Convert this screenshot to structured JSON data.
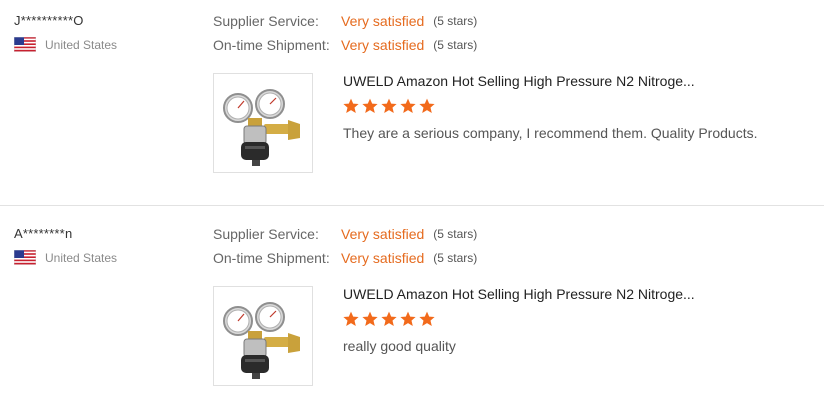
{
  "reviews": [
    {
      "buyer": "J**********O",
      "country": "United States",
      "supplier_service_label": "Supplier Service:",
      "supplier_service_value": "Very satisfied",
      "supplier_service_stars": "(5 stars)",
      "shipment_label": "On-time Shipment:",
      "shipment_value": "Very satisfied",
      "shipment_stars": "(5 stars)",
      "product_title": "UWELD Amazon Hot Selling High Pressure N2 Nitroge...",
      "rating": 5,
      "comment": "They are a serious company, I recommend them. Quality Products."
    },
    {
      "buyer": "A********n",
      "country": "United States",
      "supplier_service_label": "Supplier Service:",
      "supplier_service_value": "Very satisfied",
      "supplier_service_stars": "(5 stars)",
      "shipment_label": "On-time Shipment:",
      "shipment_value": "Very satisfied",
      "shipment_stars": "(5 stars)",
      "product_title": "UWELD Amazon Hot Selling High Pressure N2 Nitroge...",
      "rating": 5,
      "comment": "really good quality"
    }
  ],
  "icons": {
    "flag": "us-flag-icon",
    "star": "star-icon",
    "product": "pressure-regulator-image"
  },
  "colors": {
    "accent": "#e56b1f",
    "star": "#f26a1b",
    "divider": "#e2e2e2"
  }
}
